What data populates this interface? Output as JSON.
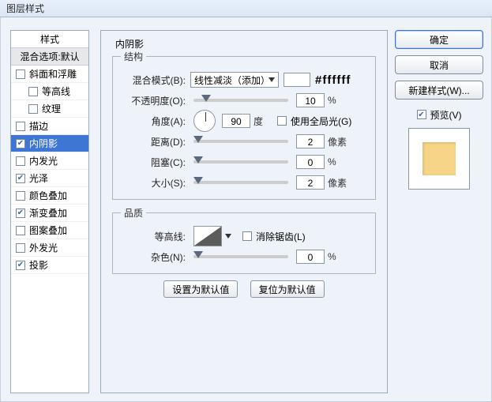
{
  "title": "图层样式",
  "styles": {
    "header": "样式",
    "blend": "混合选项:默认",
    "items": [
      {
        "label": "斜面和浮雕",
        "checked": false,
        "indent": false
      },
      {
        "label": "等高线",
        "checked": false,
        "indent": true
      },
      {
        "label": "纹理",
        "checked": false,
        "indent": true
      },
      {
        "label": "描边",
        "checked": false,
        "indent": false
      },
      {
        "label": "内阴影",
        "checked": true,
        "indent": false,
        "selected": true
      },
      {
        "label": "内发光",
        "checked": false,
        "indent": false
      },
      {
        "label": "光泽",
        "checked": true,
        "indent": false
      },
      {
        "label": "颜色叠加",
        "checked": false,
        "indent": false
      },
      {
        "label": "渐变叠加",
        "checked": true,
        "indent": false
      },
      {
        "label": "图案叠加",
        "checked": false,
        "indent": false
      },
      {
        "label": "外发光",
        "checked": false,
        "indent": false
      },
      {
        "label": "投影",
        "checked": true,
        "indent": false
      }
    ]
  },
  "panel": {
    "title": "内阴影",
    "structure": {
      "legend": "结构",
      "blendMode": {
        "label": "混合模式(B):",
        "value": "线性减淡（添加）",
        "hex": "#ffffff"
      },
      "opacity": {
        "label": "不透明度(O):",
        "value": "10",
        "unit": "%"
      },
      "angle": {
        "label": "角度(A):",
        "value": "90",
        "unit": "度",
        "globalLabel": "使用全局光(G)",
        "globalChecked": false
      },
      "distance": {
        "label": "距离(D):",
        "value": "2",
        "unit": "像素"
      },
      "choke": {
        "label": "阻塞(C):",
        "value": "0",
        "unit": "%"
      },
      "size": {
        "label": "大小(S):",
        "value": "2",
        "unit": "像素"
      }
    },
    "quality": {
      "legend": "品质",
      "contour": {
        "label": "等高线:",
        "antiAlias": "消除锯齿(L)",
        "antiAliasChecked": false
      },
      "noise": {
        "label": "杂色(N):",
        "value": "0",
        "unit": "%"
      }
    },
    "buttons": {
      "setDefault": "设置为默认值",
      "resetDefault": "复位为默认值"
    }
  },
  "right": {
    "ok": "确定",
    "cancel": "取消",
    "newStyle": "新建样式(W)...",
    "previewLabel": "预览(V)",
    "previewChecked": true
  }
}
